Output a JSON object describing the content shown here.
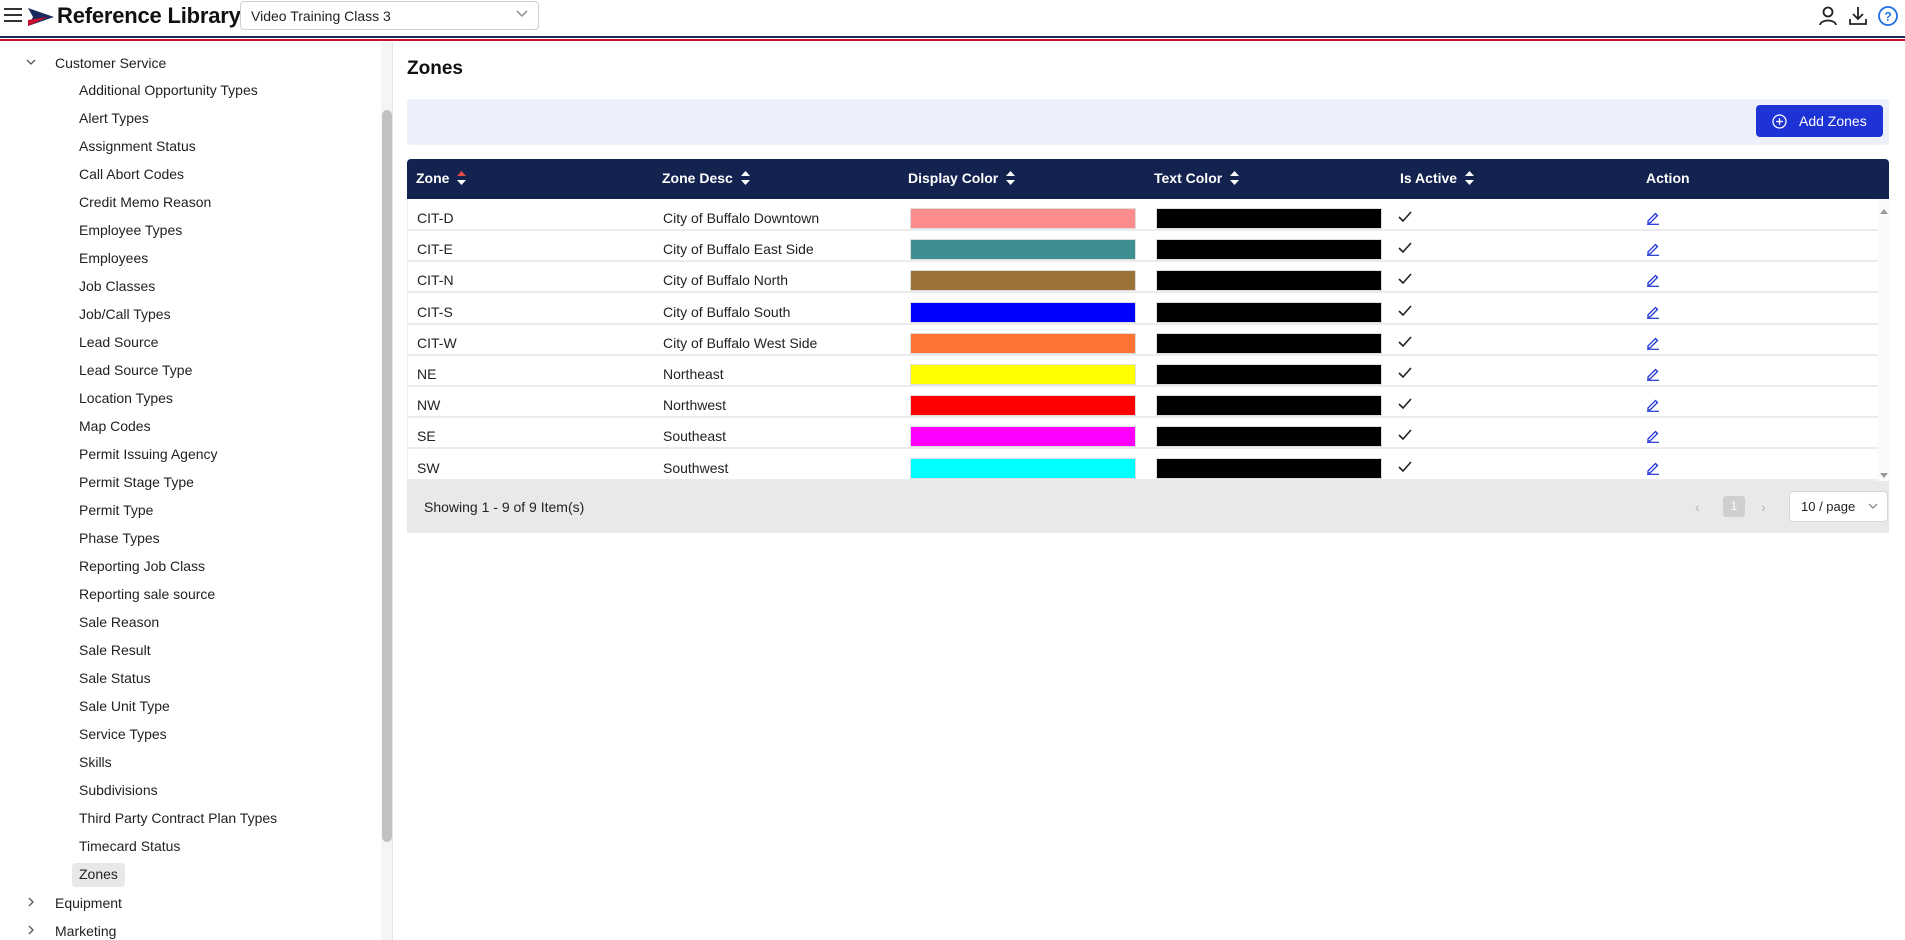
{
  "header": {
    "app_title": "Reference Library",
    "account_select_value": "Video Training Class 3",
    "brand_colors": {
      "navy": "#1b2a5c",
      "red": "#c8102e"
    }
  },
  "sidebar": {
    "groups": [
      {
        "label": "Customer Service",
        "expanded": true
      },
      {
        "label": "Equipment",
        "expanded": false
      },
      {
        "label": "Marketing",
        "expanded": false
      }
    ],
    "items": [
      {
        "label": "Additional Opportunity Types"
      },
      {
        "label": "Alert Types"
      },
      {
        "label": "Assignment Status"
      },
      {
        "label": "Call Abort Codes"
      },
      {
        "label": "Credit Memo Reason"
      },
      {
        "label": "Employee Types"
      },
      {
        "label": "Employees"
      },
      {
        "label": "Job Classes"
      },
      {
        "label": "Job/Call Types"
      },
      {
        "label": "Lead Source"
      },
      {
        "label": "Lead Source Type"
      },
      {
        "label": "Location Types"
      },
      {
        "label": "Map Codes"
      },
      {
        "label": "Permit Issuing Agency"
      },
      {
        "label": "Permit Stage Type"
      },
      {
        "label": "Permit Type"
      },
      {
        "label": "Phase Types"
      },
      {
        "label": "Reporting Job Class"
      },
      {
        "label": "Reporting sale source"
      },
      {
        "label": "Sale Reason"
      },
      {
        "label": "Sale Result"
      },
      {
        "label": "Sale Status"
      },
      {
        "label": "Sale Unit Type"
      },
      {
        "label": "Service Types"
      },
      {
        "label": "Skills"
      },
      {
        "label": "Subdivisions"
      },
      {
        "label": "Third Party Contract Plan Types"
      },
      {
        "label": "Timecard Status"
      },
      {
        "label": "Zones",
        "active": true
      }
    ]
  },
  "main": {
    "title": "Zones",
    "add_button_label": "Add Zones",
    "accent_color": "#1d33d6",
    "columns": [
      "Zone",
      "Zone Desc",
      "Display Color",
      "Text Color",
      "Is Active",
      "Action"
    ],
    "rows": [
      {
        "zone": "CIT-D",
        "desc": "City of Buffalo Downtown",
        "display_color": "#ff8c8c",
        "text_color": "#000000",
        "active": true
      },
      {
        "zone": "CIT-E",
        "desc": "City of Buffalo East Side",
        "display_color": "#3e8f91",
        "text_color": "#000000",
        "active": true
      },
      {
        "zone": "CIT-N",
        "desc": "City of Buffalo North",
        "display_color": "#9b7238",
        "text_color": "#000000",
        "active": true
      },
      {
        "zone": "CIT-S",
        "desc": "City of Buffalo South",
        "display_color": "#0000ff",
        "text_color": "#000000",
        "active": true
      },
      {
        "zone": "CIT-W",
        "desc": "City of Buffalo West Side",
        "display_color": "#ff7433",
        "text_color": "#000000",
        "active": true
      },
      {
        "zone": "NE",
        "desc": "Northeast",
        "display_color": "#ffff00",
        "text_color": "#000000",
        "active": true
      },
      {
        "zone": "NW",
        "desc": "Northwest",
        "display_color": "#ff0000",
        "text_color": "#000000",
        "active": true
      },
      {
        "zone": "SE",
        "desc": "Southeast",
        "display_color": "#ff00ff",
        "text_color": "#000000",
        "active": true
      },
      {
        "zone": "SW",
        "desc": "Southwest",
        "display_color": "#00ffff",
        "text_color": "#000000",
        "active": true
      }
    ],
    "footer": {
      "showing_text": "Showing 1 - 9 of 9 Item(s)",
      "current_page": "1",
      "page_size": "10 / page"
    }
  }
}
